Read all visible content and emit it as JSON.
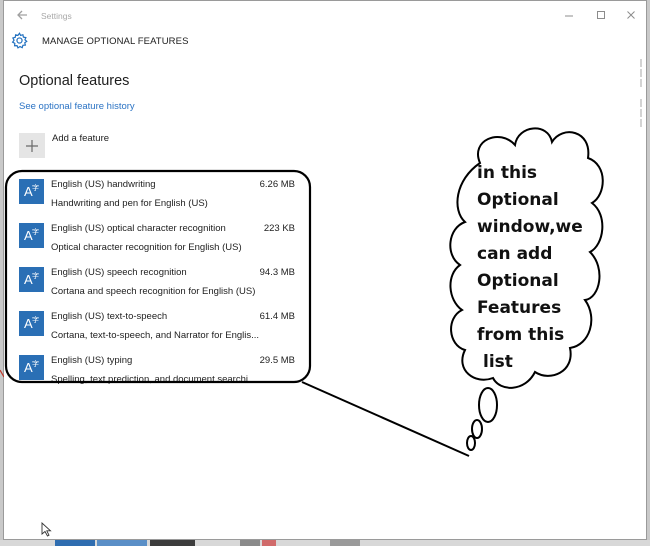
{
  "window": {
    "title": "Settings",
    "header_label": "MANAGE OPTIONAL FEATURES"
  },
  "page": {
    "title": "Optional features",
    "history_link": "See optional feature history",
    "add_feature_label": "Add a feature"
  },
  "features": [
    {
      "name": "English (US) handwriting",
      "size": "6.26 MB",
      "desc": "Handwriting and pen for English (US)"
    },
    {
      "name": "English (US) optical character recognition",
      "size": "223 KB",
      "desc": "Optical character recognition for English (US)"
    },
    {
      "name": "English (US) speech recognition",
      "size": "94.3 MB",
      "desc": "Cortana and speech recognition for English (US)"
    },
    {
      "name": "English (US) text-to-speech",
      "size": "61.4 MB",
      "desc": "Cortana, text-to-speech, and Narrator for Englis..."
    },
    {
      "name": "English (US) typing",
      "size": "29.5 MB",
      "desc": "Spelling, text prediction, and document searchi..."
    }
  ],
  "callout": {
    "lines": [
      "in this",
      "Optional",
      "window,we",
      "can add",
      "Optional",
      "Features",
      "from this",
      "list"
    ]
  },
  "colors": {
    "accent": "#2a6fb5",
    "link": "#2b73c4",
    "annotation_stroke": "#000000"
  },
  "icons": {
    "back": "back-arrow-icon",
    "gear": "gear-icon",
    "add": "plus-icon",
    "feature": "language-feature-icon"
  }
}
